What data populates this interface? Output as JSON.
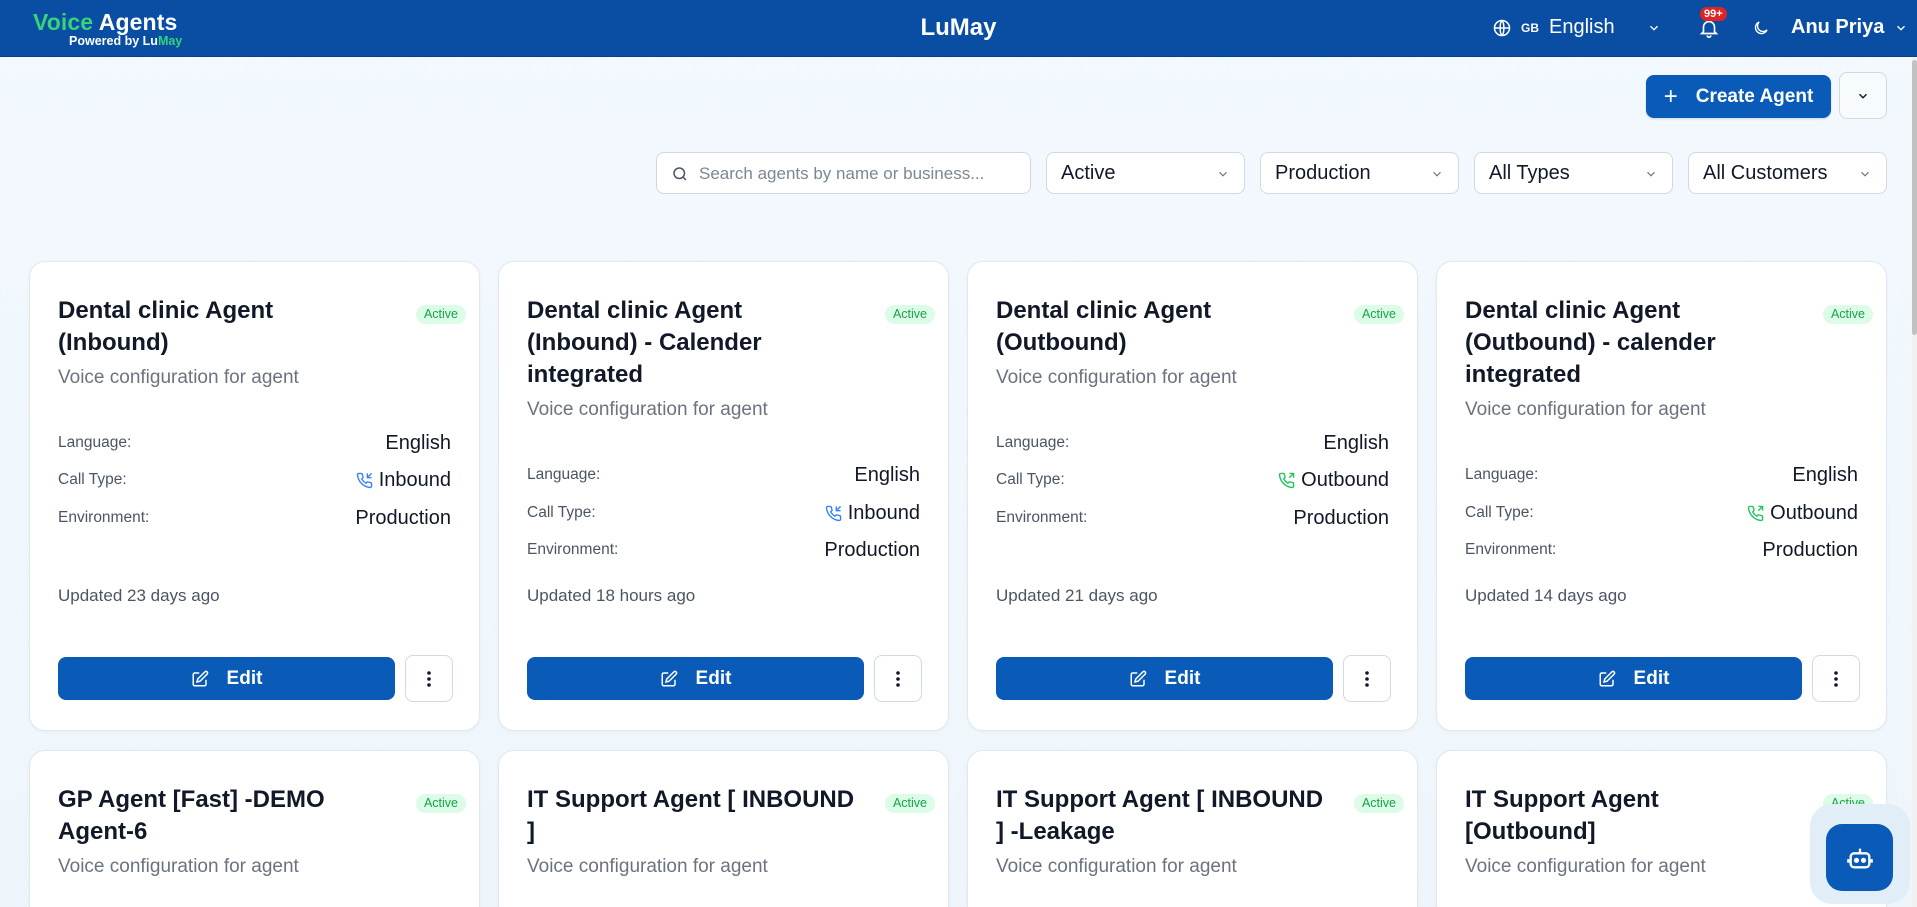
{
  "header": {
    "brand_voice": "Voice",
    "brand_agents": "Agents",
    "brand_powered": "Powered by",
    "brand_lu": "Lu",
    "brand_may": "May",
    "center_title": "LuMay",
    "lang_code": "GB",
    "lang_name": "English",
    "notifications_count": "99+",
    "user_name": "Anu Priya"
  },
  "toolbar": {
    "create_label": "Create Agent"
  },
  "filters": {
    "search_placeholder": "Search agents by name or business...",
    "status": "Active",
    "environment": "Production",
    "type": "All Types",
    "customer": "All Customers"
  },
  "labels": {
    "language": "Language:",
    "call_type": "Call Type:",
    "environment": "Environment:",
    "edit": "Edit"
  },
  "agents": [
    {
      "title": "Dental clinic Agent (Inbound)",
      "status": "Active",
      "description": "Voice configuration for agent",
      "language": "English",
      "call_type": "Inbound",
      "environment": "Production",
      "updated": "Updated 23 days ago"
    },
    {
      "title": "Dental clinic Agent (Inbound) - Calender integrated",
      "status": "Active",
      "description": "Voice configuration for agent",
      "language": "English",
      "call_type": "Inbound",
      "environment": "Production",
      "updated": "Updated 18 hours ago"
    },
    {
      "title": "Dental clinic Agent (Outbound)",
      "status": "Active",
      "description": "Voice configuration for agent",
      "language": "English",
      "call_type": "Outbound",
      "environment": "Production",
      "updated": "Updated 21 days ago"
    },
    {
      "title": "Dental clinic Agent (Outbound) - calender integrated",
      "status": "Active",
      "description": "Voice configuration for agent",
      "language": "English",
      "call_type": "Outbound",
      "environment": "Production",
      "updated": "Updated 14 days ago"
    },
    {
      "title": "GP Agent [Fast] -DEMO Agent-6",
      "status": "Active",
      "description": "Voice configuration for agent"
    },
    {
      "title": "IT Support Agent [ INBOUND ]",
      "status": "Active",
      "description": "Voice configuration for agent"
    },
    {
      "title": "IT Support Agent [ INBOUND ] -Leakage",
      "status": "Active",
      "description": "Voice configuration for agent"
    },
    {
      "title": "IT Support Agent [Outbound]",
      "status": "Active",
      "description": "Voice configuration for agent"
    }
  ],
  "colors": {
    "header_bg": "#0a4ea3",
    "primary": "#0a5ab8",
    "active_badge_bg": "#dcfce7",
    "active_badge_text": "#16a34a",
    "inbound_icon": "#3b82f6",
    "outbound_icon": "#22c55e"
  },
  "icons": {
    "inbound": "phone-incoming-icon",
    "outbound": "phone-outgoing-icon",
    "edit": "pencil-square-icon",
    "more": "vertical-dots-icon",
    "chat": "bot-icon"
  }
}
